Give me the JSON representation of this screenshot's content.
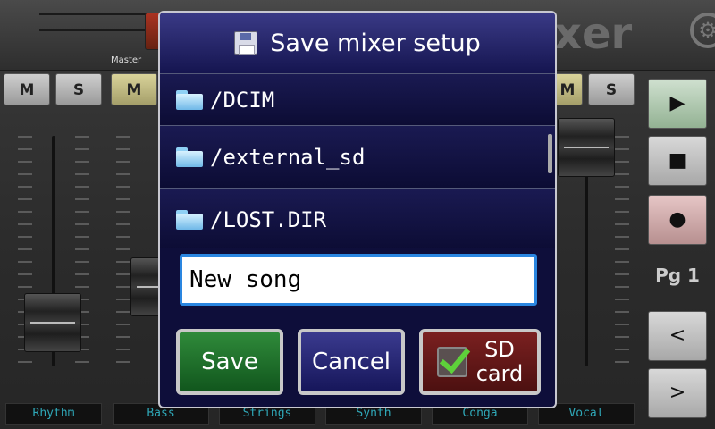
{
  "background": {
    "master_label": "Master",
    "logo_text": "xer",
    "channels": [
      {
        "mute": "M",
        "solo": "S",
        "label": "Rhythm"
      },
      {
        "mute": "M",
        "label": "Bass"
      },
      {
        "label": "Strings"
      },
      {
        "label": "Synth"
      },
      {
        "label": "Conga"
      },
      {
        "mute": "M",
        "solo": "S",
        "label": "Vocal"
      }
    ],
    "sidebar": {
      "play_icon": "▶",
      "stop_icon": "■",
      "record_icon": "●",
      "page_label": "Pg 1",
      "prev_icon": "<",
      "next_icon": ">"
    }
  },
  "dialog": {
    "title": "Save mixer setup",
    "folders": [
      "/DCIM",
      "/external_sd",
      "/LOST.DIR"
    ],
    "filename_value": "New song",
    "save_label": "Save",
    "cancel_label": "Cancel",
    "sd_label_line1": "SD",
    "sd_label_line2": "card",
    "sd_checked": true
  },
  "colors": {
    "dialog_bg": "#0e0e3a",
    "title_bg": "#2a2a78",
    "save_green": "#1f6e2a",
    "cancel_blue": "#26266e",
    "sd_red": "#641818",
    "input_border": "#2a86e0",
    "channel_label": "#2fa8b8"
  }
}
